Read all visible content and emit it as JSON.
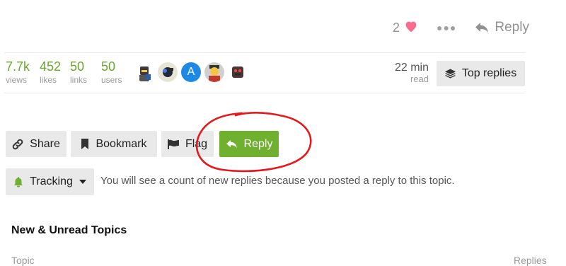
{
  "post_actions": {
    "like_count": "2",
    "reply_label": "Reply"
  },
  "stats": [
    {
      "value": "7.7k",
      "label": "views"
    },
    {
      "value": "452",
      "label": "likes"
    },
    {
      "value": "50",
      "label": "links"
    },
    {
      "value": "50",
      "label": "users"
    }
  ],
  "avatars": [
    {
      "type": "image",
      "color": "#3b3b3b"
    },
    {
      "type": "image",
      "color": "#2a3b55"
    },
    {
      "type": "letter",
      "letter": "A",
      "color": "#1e88e5"
    },
    {
      "type": "image",
      "color": "#c0392b"
    },
    {
      "type": "image",
      "color": "#5a3b3b"
    }
  ],
  "read_time": {
    "value": "22 min",
    "label": "read"
  },
  "top_replies_label": "Top replies",
  "footer_buttons": {
    "share": "Share",
    "bookmark": "Bookmark",
    "flag": "Flag",
    "reply": "Reply"
  },
  "tracking": {
    "label": "Tracking",
    "description": "You will see a count of new replies because you posted a reply to this topic."
  },
  "suggested": {
    "title": "New & Unread Topics",
    "col_topic": "Topic",
    "col_replies": "Replies"
  },
  "colors": {
    "accent_green": "#6fb02f",
    "stat_green": "#6aa52e",
    "heart_pink": "#fa6c8d",
    "annotation_red": "#e3191e"
  }
}
